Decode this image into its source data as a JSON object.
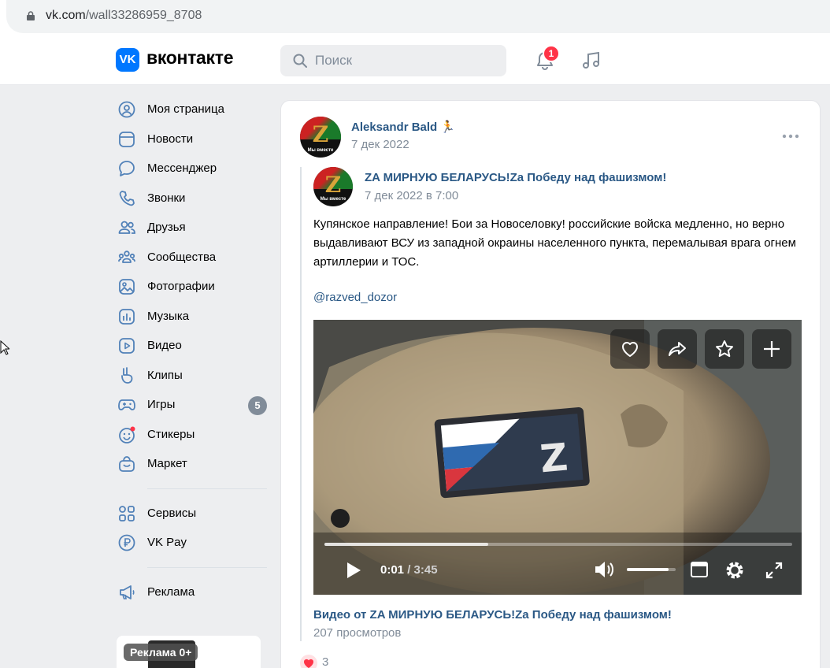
{
  "browser": {
    "url_host": "vk.com",
    "url_path": "/wall33286959_8708"
  },
  "header": {
    "logo_mark": "VK",
    "logo_text": "вконтакте",
    "search_placeholder": "Поиск",
    "notifications_count": "1"
  },
  "sidebar": {
    "items": [
      {
        "label": "Моя страница",
        "icon": "user-circle-icon"
      },
      {
        "label": "Новости",
        "icon": "newsfeed-icon"
      },
      {
        "label": "Мессенджер",
        "icon": "message-icon"
      },
      {
        "label": "Звонки",
        "icon": "phone-icon"
      },
      {
        "label": "Друзья",
        "icon": "friends-icon"
      },
      {
        "label": "Сообщества",
        "icon": "communities-icon"
      },
      {
        "label": "Фотографии",
        "icon": "photo-icon"
      },
      {
        "label": "Музыка",
        "icon": "music-icon"
      },
      {
        "label": "Видео",
        "icon": "video-icon"
      },
      {
        "label": "Клипы",
        "icon": "clips-icon"
      },
      {
        "label": "Игры",
        "icon": "gamepad-icon",
        "count": "5"
      },
      {
        "label": "Стикеры",
        "icon": "sticker-icon"
      },
      {
        "label": "Маркет",
        "icon": "market-bag-icon"
      }
    ],
    "services": [
      {
        "label": "Сервисы",
        "icon": "services-grid-icon"
      },
      {
        "label": "VK Pay",
        "icon": "vkpay-icon"
      }
    ],
    "ads_label": "Реклама",
    "ad_badge": "Реклама 0+"
  },
  "post": {
    "author": "Aleksandr Bald",
    "author_emoji": "🏃",
    "date": "7 дек 2022",
    "repost": {
      "group_name": "ZA МИРНУЮ БЕЛАРУСЬ!Za Победу над фашизмом!",
      "date": "7 дек 2022 в 7:00",
      "text": "Купянское направление! Бои за Новоселовку! российские войска медленно, но верно выдавливают ВСУ из западной окраины населенного пункта, перемалывая врага огнем артиллерии и ТОС.",
      "mention": "@razved_dozor",
      "video": {
        "time_current": "0:01",
        "time_total": "3:45",
        "progress_fraction": 0.004,
        "volume_fraction": 0.85,
        "title": "Видео от ZA МИРНУЮ БЕЛАРУСЬ!Za Победу над фашизмом!",
        "views": "207 просмотров"
      }
    },
    "likes": "3",
    "avatar_letter": "Z",
    "avatar_caption": "Мы вместе"
  },
  "colors": {
    "accent": "#0077ff",
    "link": "#2a5885",
    "secondary": "#818c99",
    "like": "#ff3347"
  }
}
